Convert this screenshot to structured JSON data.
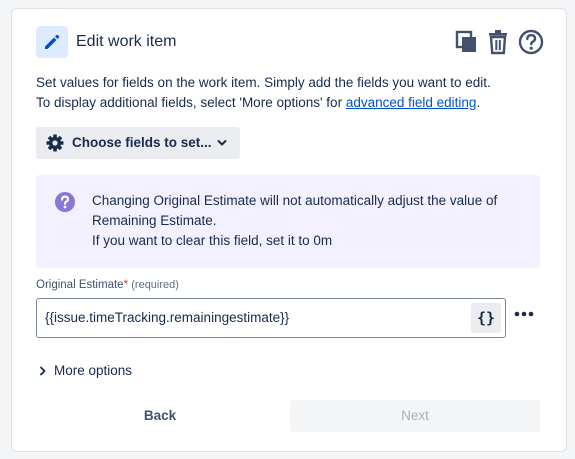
{
  "header": {
    "title": "Edit work item",
    "icons": [
      "pencil-icon",
      "copy-icon",
      "trash-icon",
      "help-icon"
    ]
  },
  "description": {
    "line1": "Set values for fields on the work item. Simply add the fields you want to edit.",
    "line2_prefix": "To display additional fields, select 'More options' for ",
    "line2_link": "advanced field editing",
    "line2_suffix": "."
  },
  "choose_fields": {
    "label": "Choose fields to set..."
  },
  "info": {
    "line1": "Changing Original Estimate will not automatically adjust the value of",
    "line2": "Remaining Estimate.",
    "line3": "If you want to clear this field, set it to 0m"
  },
  "field": {
    "label": "Original Estimate",
    "required_mark": "*",
    "required_text": "(required)",
    "value": "{{issue.timeTracking.remainingestimate}}",
    "smart_value_button": "{}"
  },
  "more_options": {
    "label": "More options"
  },
  "footer": {
    "back_label": "Back",
    "next_label": "Next"
  },
  "colors": {
    "accent": "#0052cc",
    "info_bg": "#f3f0ff",
    "info_icon": "#8777d9",
    "required": "#de350b"
  }
}
